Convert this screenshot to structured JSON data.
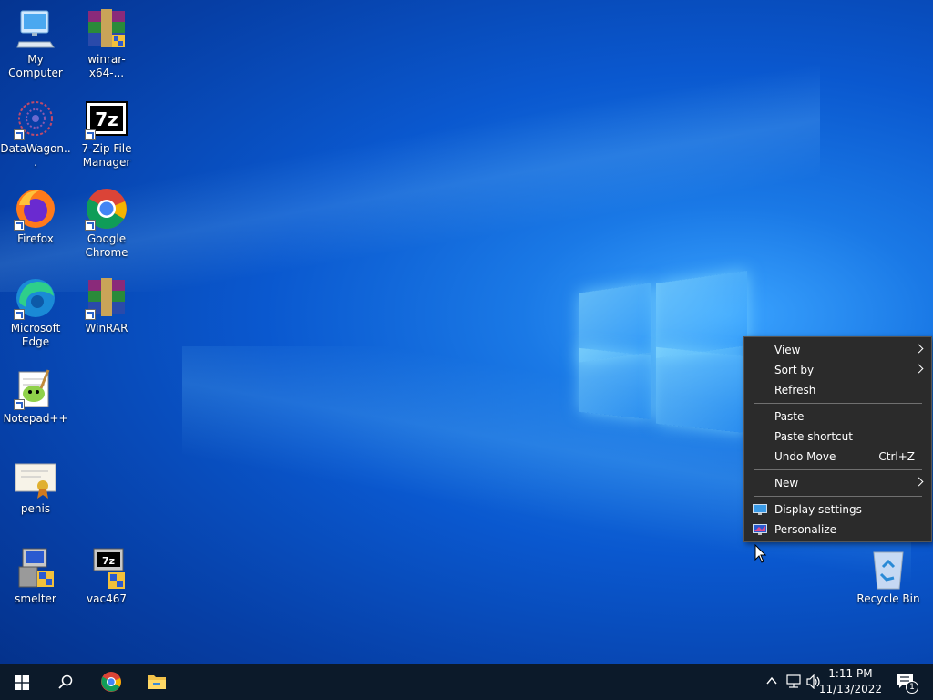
{
  "desktop": {
    "icons": [
      {
        "label": "My Computer",
        "icon": "computer-icon"
      },
      {
        "label": "winrar-x64-...",
        "icon": "winrar-icon"
      },
      {
        "label": "DataWagon...",
        "icon": "datawagon-icon"
      },
      {
        "label": "7-Zip File Manager",
        "icon": "7zip-icon"
      },
      {
        "label": "Firefox",
        "icon": "firefox-icon"
      },
      {
        "label": "Google Chrome",
        "icon": "chrome-icon"
      },
      {
        "label": "Microsoft Edge",
        "icon": "edge-icon"
      },
      {
        "label": "WinRAR",
        "icon": "winrar-icon"
      },
      {
        "label": "Notepad++",
        "icon": "notepadpp-icon"
      },
      {
        "label": "penis",
        "icon": "certificate-icon"
      },
      {
        "label": "smelter",
        "icon": "installer-icon"
      },
      {
        "label": "vac467",
        "icon": "7z-installer-icon"
      },
      {
        "label": "Recycle Bin",
        "icon": "recycle-bin-icon"
      }
    ]
  },
  "context_menu": {
    "items": [
      {
        "label": "View",
        "submenu": true
      },
      {
        "label": "Sort by",
        "submenu": true
      },
      {
        "label": "Refresh"
      },
      {
        "label": "Paste"
      },
      {
        "label": "Paste shortcut"
      },
      {
        "label": "Undo Move",
        "shortcut": "Ctrl+Z"
      },
      {
        "label": "New",
        "submenu": true
      },
      {
        "label": "Display settings",
        "icon": "display-settings-icon"
      },
      {
        "label": "Personalize",
        "icon": "personalize-icon"
      }
    ]
  },
  "taskbar": {
    "time": "1:11 PM",
    "date": "11/13/2022",
    "notification_count": "1",
    "pinned": [
      "start-icon",
      "search-icon",
      "chrome-icon",
      "file-explorer-icon"
    ]
  },
  "colors": {
    "taskbar_bg": "#0c1a2a",
    "menu_bg": "#2b2b2b",
    "menu_sep": "#707070"
  }
}
